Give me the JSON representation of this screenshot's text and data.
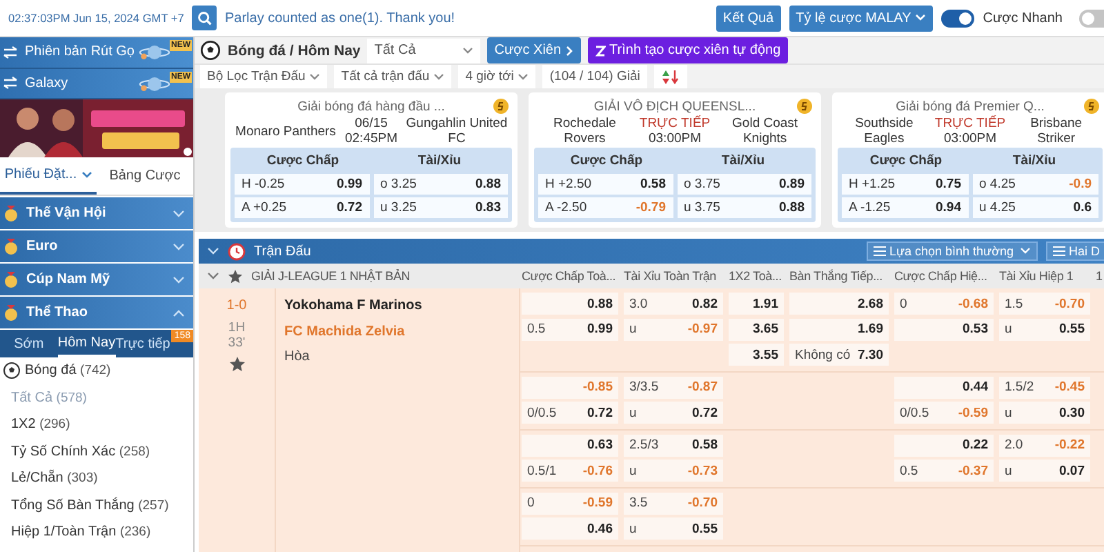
{
  "top_bar": {
    "clock": "02:37:03PM Jun 15, 2024 GMT +7",
    "notice": "Parlay counted as one(1). Thank you!",
    "results_button": "Kết Quả",
    "odds_type": "Tỷ lệ cược MALAY",
    "toggles": [
      {
        "label": "Cược Nhanh",
        "on": true
      },
      {
        "on": false
      }
    ]
  },
  "sidebar": {
    "banners": [
      {
        "label": "Phiên bản Rút Gọ",
        "badge": "NEW"
      },
      {
        "label": "Galaxy",
        "badge": "NEW"
      }
    ],
    "tabs": [
      {
        "label": "Phiếu Đặt...",
        "selected": true
      },
      {
        "label": "Bảng Cược",
        "selected": false
      }
    ],
    "categories": [
      {
        "label": "Thế Vận Hội",
        "expanded": false
      },
      {
        "label": "Euro",
        "expanded": false
      },
      {
        "label": "Cúp Nam Mỹ",
        "expanded": false
      },
      {
        "label": "Thể Thao",
        "expanded": true
      }
    ],
    "subtabs": [
      {
        "label": "Sớm",
        "selected": false
      },
      {
        "label": "Hôm Nay",
        "selected": true
      },
      {
        "label": "Trực tiếp",
        "selected": false,
        "badge": "158"
      }
    ],
    "items": [
      {
        "kind": "sport",
        "label": "Bóng đá",
        "count": "(742)"
      },
      {
        "kind": "all",
        "label": "Tất Cả",
        "count": "(578)"
      },
      {
        "kind": "market",
        "label": "1X2",
        "count": "(296)"
      },
      {
        "kind": "market",
        "label": "Tỷ Số Chính Xác",
        "count": "(258)"
      },
      {
        "kind": "market",
        "label": "Lẻ/Chẵn",
        "count": "(303)"
      },
      {
        "kind": "market",
        "label": "Tổng Số Bàn Thắng",
        "count": "(257)"
      },
      {
        "kind": "market",
        "label": "Hiệp 1/Toàn Trận",
        "count": "(236)"
      }
    ]
  },
  "toolbar": {
    "title": "Bóng đá / Hôm Nay",
    "filter": "Tất Cả",
    "parlay_button": "Cược Xiên",
    "builder_button": "Trình tạo cược xiên tự động",
    "filters": [
      "Bộ Lọc Trận Đấu",
      "Tất cả trận đấu",
      "4 giờ tới"
    ],
    "league_count": "(104 / 104) Giải"
  },
  "featured": [
    {
      "league": "Giải bóng đá hàng đầu ...",
      "home": "Monaro Panthers",
      "away": "Gungahlin United FC",
      "status": "06/15",
      "live": false,
      "time": "02:45PM",
      "hdp": [
        {
          "line": "H -0.25",
          "odd": "0.99",
          "negative": false
        },
        {
          "line": "A +0.25",
          "odd": "0.72",
          "negative": false
        }
      ],
      "ou": [
        {
          "line": "o 3.25",
          "odd": "0.88",
          "negative": false
        },
        {
          "line": "u 3.25",
          "odd": "0.83",
          "negative": false
        }
      ]
    },
    {
      "league": "GIẢI VÔ ĐỊCH QUEENSL...",
      "home": "Rochedale Rovers",
      "away": "Gold Coast Knights",
      "status": "TRỰC TIẾP",
      "live": true,
      "time": "03:00PM",
      "hdp": [
        {
          "line": "H +2.50",
          "odd": "0.58",
          "negative": false
        },
        {
          "line": "A -2.50",
          "odd": "-0.79",
          "negative": true
        }
      ],
      "ou": [
        {
          "line": "o 3.75",
          "odd": "0.89",
          "negative": false
        },
        {
          "line": "u 3.75",
          "odd": "0.88",
          "negative": false
        }
      ]
    },
    {
      "league": "Giải bóng đá Premier Q...",
      "home": "Southside Eagles",
      "away": "Brisbane Striker",
      "status": "TRỰC TIẾP",
      "live": true,
      "time": "03:00PM",
      "hdp": [
        {
          "line": "H +1.25",
          "odd": "0.75",
          "negative": false
        },
        {
          "line": "A -1.25",
          "odd": "0.94",
          "negative": false
        }
      ],
      "ou": [
        {
          "line": "o 4.25",
          "odd": "-0.9",
          "negative": true
        },
        {
          "line": "u 4.25",
          "odd": "0.6",
          "negative": false
        }
      ]
    }
  ],
  "featured_headers": [
    [
      "Cược Chấp",
      "Tài/Xỉu"
    ],
    [
      "Cược Chấp",
      "Tài/Xỉu"
    ],
    [
      "Cược Chấp",
      "Tài/Xỉu"
    ]
  ],
  "table": {
    "title": "Trận Đấu",
    "view_button": "Lựa chọn bình thường",
    "layout_button": "Hai D",
    "league": "GIẢI J-LEAGUE 1 NHẬT BẢN",
    "columns": [
      "Cược Chấp Toà...",
      "Tài Xỉu Toàn Trận",
      "1X2 Toà...",
      "Bàn Thắng Tiếp...",
      "Cược Chấp Hiệ...",
      "Tài Xỉu Hiệp 1",
      "1"
    ],
    "match": {
      "score": "1-0",
      "period": "1H",
      "minute": "33'",
      "home": "Yokohama F Marinos",
      "away": "FC Machida Zelvia",
      "draw": "Hòa"
    },
    "groups": [
      {
        "lines": [
          {
            "hdp_ft": {
              "odd": "0.88",
              "negative": false
            },
            "ou_ft": {
              "line": "3.0",
              "odd": "0.82",
              "negative": false
            },
            "x12_ft": {
              "odd": "1.91",
              "negative": false
            },
            "next_goal": {
              "odd": "2.68",
              "negative": false
            },
            "hdp_1h": {
              "line": "0",
              "odd": "-0.68",
              "negative": true
            },
            "ou_1h": {
              "line": "1.5",
              "odd": "-0.70",
              "negative": true
            }
          },
          {
            "hdp_ft": {
              "line": "0.5",
              "odd": "0.99",
              "negative": false
            },
            "ou_ft": {
              "line": "u",
              "odd": "-0.97",
              "negative": true
            },
            "x12_ft": {
              "odd": "3.65",
              "negative": false
            },
            "next_goal": {
              "odd": "1.69",
              "negative": false
            },
            "hdp_1h": {
              "odd": "0.53",
              "negative": false
            },
            "ou_1h": {
              "line": "u",
              "odd": "0.55",
              "negative": false
            }
          },
          {
            "x12_ft": {
              "odd": "3.55",
              "negative": false
            },
            "next_goal": {
              "line": "Không có",
              "odd": "7.30",
              "negative": false
            }
          }
        ]
      },
      {
        "lines": [
          {
            "hdp_ft": {
              "odd": "-0.85",
              "negative": true
            },
            "ou_ft": {
              "line": "3/3.5",
              "odd": "-0.87",
              "negative": true
            },
            "hdp_1h": {
              "odd": "0.44",
              "negative": false
            },
            "ou_1h": {
              "line": "1.5/2",
              "odd": "-0.45",
              "negative": true
            }
          },
          {
            "hdp_ft": {
              "line": "0/0.5",
              "odd": "0.72",
              "negative": false
            },
            "ou_ft": {
              "line": "u",
              "odd": "0.72",
              "negative": false
            },
            "hdp_1h": {
              "line": "0/0.5",
              "odd": "-0.59",
              "negative": true
            },
            "ou_1h": {
              "line": "u",
              "odd": "0.30",
              "negative": false
            }
          }
        ]
      },
      {
        "lines": [
          {
            "hdp_ft": {
              "odd": "0.63",
              "negative": false
            },
            "ou_ft": {
              "line": "2.5/3",
              "odd": "0.58",
              "negative": false
            },
            "hdp_1h": {
              "odd": "0.22",
              "negative": false
            },
            "ou_1h": {
              "line": "2.0",
              "odd": "-0.22",
              "negative": true
            }
          },
          {
            "hdp_ft": {
              "line": "0.5/1",
              "odd": "-0.76",
              "negative": true
            },
            "ou_ft": {
              "line": "u",
              "odd": "-0.73",
              "negative": true
            },
            "hdp_1h": {
              "line": "0.5",
              "odd": "-0.37",
              "negative": true
            },
            "ou_1h": {
              "line": "u",
              "odd": "0.07",
              "negative": false
            }
          }
        ]
      },
      {
        "lines": [
          {
            "hdp_ft": {
              "line": "0",
              "odd": "-0.59",
              "negative": true
            },
            "ou_ft": {
              "line": "3.5",
              "odd": "-0.70",
              "negative": true
            }
          },
          {
            "hdp_ft": {
              "odd": "0.46",
              "negative": false
            },
            "ou_ft": {
              "line": "u",
              "odd": "0.55",
              "negative": false
            }
          }
        ]
      }
    ]
  }
}
